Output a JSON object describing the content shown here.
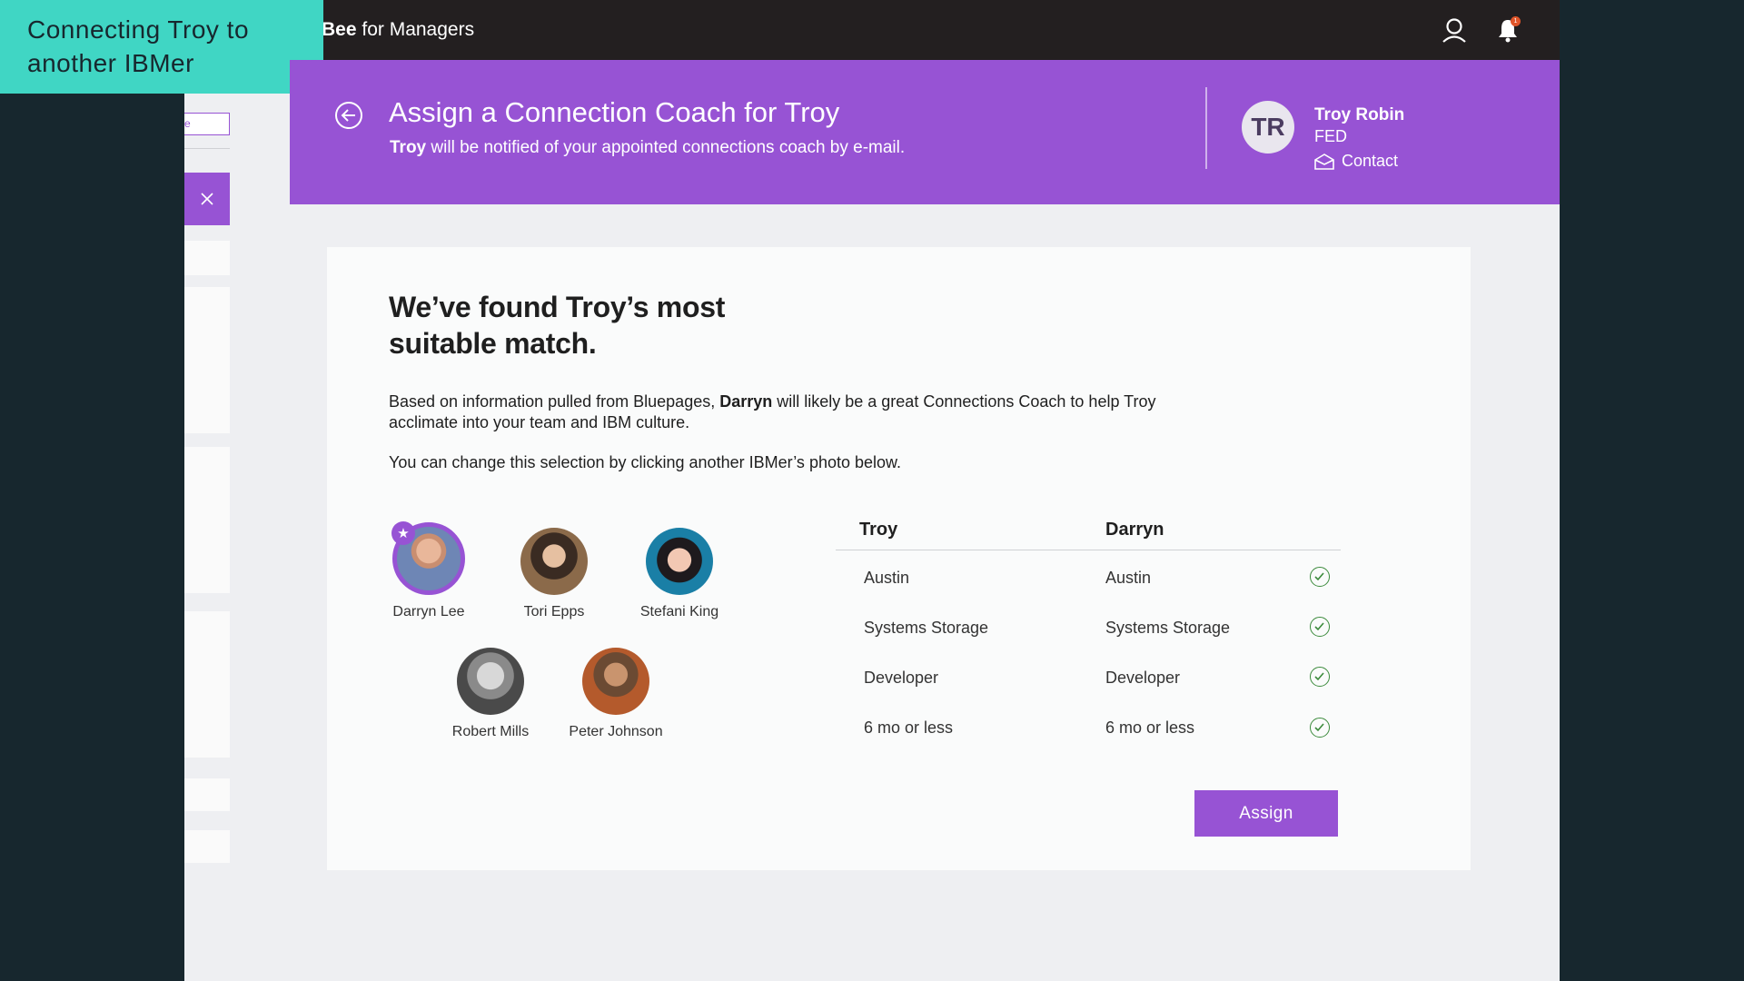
{
  "overlay": {
    "label": "Connecting Troy to another IBMer"
  },
  "topbar": {
    "brand_bold": "Bee",
    "brand_rest": " for Managers",
    "notification_count": "1"
  },
  "sidebar": {
    "input_fragment": "e"
  },
  "header": {
    "title": "Assign a Connection Coach for Troy",
    "subtitle_name": "Troy",
    "subtitle_rest": " will be notified of your appointed connections coach by e-mail.",
    "avatar_initials": "TR",
    "person_name": "Troy Robin",
    "person_role": "FED",
    "contact_label": "Contact"
  },
  "card": {
    "title": "We’ve found Troy’s most suitable match.",
    "desc_part1": "Based on information pulled from Bluepages, ",
    "desc_bold": "Darryn",
    "desc_part2": " will likely be a great Connections Coach to help Troy acclimate into your team and IBM culture.",
    "desc2": "You can change this selection by clicking another IBMer’s photo below.",
    "people": [
      {
        "name": "Darryn Lee",
        "selected": true
      },
      {
        "name": "Tori Epps",
        "selected": false
      },
      {
        "name": "Stefani King",
        "selected": false
      },
      {
        "name": "Robert Mills",
        "selected": false
      },
      {
        "name": "Peter Johnson",
        "selected": false
      }
    ],
    "compare": {
      "col_a": "Troy",
      "col_b": "Darryn",
      "rows": [
        {
          "a": "Austin",
          "b": "Austin"
        },
        {
          "a": "Systems Storage",
          "b": "Systems Storage"
        },
        {
          "a": "Developer",
          "b": "Developer"
        },
        {
          "a": "6 mo or less",
          "b": "6 mo or less"
        }
      ]
    },
    "assign_label": "Assign"
  },
  "colors": {
    "accent": "#9753d4",
    "teal": "#40d6c4",
    "dark": "#231f20",
    "check": "#3b8a3b"
  }
}
